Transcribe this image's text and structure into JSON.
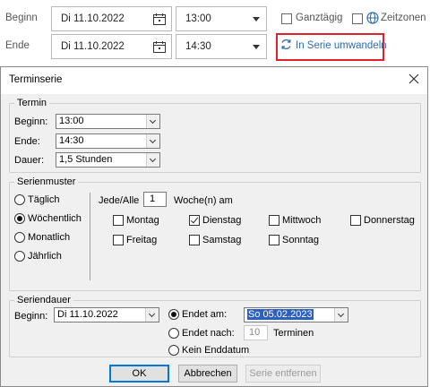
{
  "appointment": {
    "begin_label": "Beginn",
    "end_label": "Ende",
    "begin_date": "Di 11.10.2022",
    "begin_time": "13:00",
    "end_date": "Di 11.10.2022",
    "end_time": "14:30",
    "all_day_label": "Ganztägig",
    "timezones_label": "Zeitzonen",
    "convert_series_label": "In Serie umwandeln",
    "highlight_color": "#e0232a",
    "link_color": "#2b6cb0"
  },
  "dialog": {
    "title": "Terminserie",
    "termin": {
      "group_label": "Termin",
      "begin_label": "Beginn:",
      "begin_value": "13:00",
      "end_label": "Ende:",
      "end_value": "14:30",
      "duration_label": "Dauer:",
      "duration_value": "1,5 Stunden"
    },
    "pattern": {
      "group_label": "Serienmuster",
      "options": [
        "Täglich",
        "Wöchentlich",
        "Monatlich",
        "Jährlich"
      ],
      "selected": "Wöchentlich",
      "every_label": "Jede/Alle",
      "every_value": "1",
      "weeks_label": "Woche(n) am",
      "days": [
        "Montag",
        "Dienstag",
        "Mittwoch",
        "Donnerstag",
        "Freitag",
        "Samstag",
        "Sonntag"
      ],
      "checked_day": "Dienstag"
    },
    "range": {
      "group_label": "Seriendauer",
      "begin_label": "Beginn:",
      "begin_value": "Di 11.10.2022",
      "ends_on_label": "Endet am:",
      "ends_on_value": "So 05.02.2023",
      "ends_after_label": "Endet nach:",
      "ends_after_value": "10",
      "occurrences_label": "Terminen",
      "no_end_label": "Kein Enddatum",
      "selected": "Endet am:"
    },
    "buttons": {
      "ok": "OK",
      "cancel": "Abbrechen",
      "remove": "Serie entfernen"
    }
  }
}
